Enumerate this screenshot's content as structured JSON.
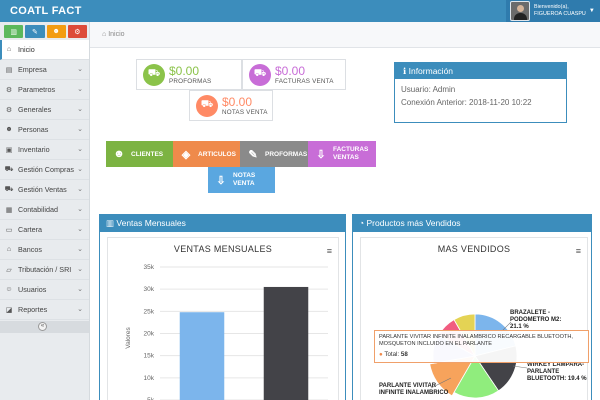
{
  "app": {
    "title": "COATL FACT"
  },
  "user": {
    "greeting": "Bienvenido(a),",
    "name": "FIGUEROA CUASPU"
  },
  "shortcuts": [
    {
      "icon": "bar-chart-icon",
      "color": "#5cb85c",
      "glyph": "▥"
    },
    {
      "icon": "pencil-icon",
      "color": "#3c8dbc",
      "glyph": "✎"
    },
    {
      "icon": "users-icon",
      "color": "#f39c12",
      "glyph": "☻"
    },
    {
      "icon": "cogs-icon",
      "color": "#dd4b39",
      "glyph": "⚙"
    }
  ],
  "sidebar": {
    "items": [
      {
        "label": "Inicio",
        "glyph": "⌂",
        "icon": "home-icon",
        "active": true,
        "chevron": false
      },
      {
        "label": "Empresa",
        "glyph": "▤",
        "icon": "building-icon",
        "active": false,
        "chevron": true
      },
      {
        "label": "Parametros",
        "glyph": "⚙",
        "icon": "gear-icon",
        "active": false,
        "chevron": true
      },
      {
        "label": "Generales",
        "glyph": "⚙",
        "icon": "cogs-icon",
        "active": false,
        "chevron": true
      },
      {
        "label": "Personas",
        "glyph": "☻",
        "icon": "users-icon",
        "active": false,
        "chevron": true
      },
      {
        "label": "Inventario",
        "glyph": "▣",
        "icon": "archive-icon",
        "active": false,
        "chevron": true
      },
      {
        "label": "Gestión Compras",
        "glyph": "⛟",
        "icon": "cart-icon",
        "active": false,
        "chevron": true
      },
      {
        "label": "Gestión Ventas",
        "glyph": "⛟",
        "icon": "cart-icon",
        "active": false,
        "chevron": true
      },
      {
        "label": "Contabilidad",
        "glyph": "▦",
        "icon": "table-icon",
        "active": false,
        "chevron": true
      },
      {
        "label": "Cartera",
        "glyph": "▭",
        "icon": "wallet-icon",
        "active": false,
        "chevron": true
      },
      {
        "label": "Bancos",
        "glyph": "⌂",
        "icon": "bank-icon",
        "active": false,
        "chevron": true
      },
      {
        "label": "Tributación / SRI",
        "glyph": "▱",
        "icon": "folder-open-icon",
        "active": false,
        "chevron": true
      },
      {
        "label": "Usuarios",
        "glyph": "☺",
        "icon": "user-icon",
        "active": false,
        "chevron": true
      },
      {
        "label": "Reportes",
        "glyph": "◪",
        "icon": "chart-icon",
        "active": false,
        "chevron": true
      }
    ]
  },
  "breadcrumb": {
    "label": "Inicio"
  },
  "stats": [
    {
      "value": "$0.00",
      "label": "PROFORMAS",
      "color": "#8bc34a",
      "glyph": "⛟"
    },
    {
      "value": "$0.00",
      "label": "FACTURAS VENTA",
      "color": "#c86dd7",
      "glyph": "⛟"
    },
    {
      "value": "$0.00",
      "label": "NOTAS VENTA",
      "color": "#ff8a65",
      "glyph": "⛟"
    }
  ],
  "info": {
    "title": "Información",
    "usuario": "Usuario: Admin",
    "conexion": "Conexión Anterior: 2018-11-20 10:22"
  },
  "quick_buttons": [
    {
      "label": "CLIENTES",
      "color": "#7cb342",
      "icon": "user-icon",
      "glyph": "☻"
    },
    {
      "label": "ARTICULOS",
      "color": "#ef8a4b",
      "icon": "cube-icon",
      "glyph": "◈"
    },
    {
      "label": "PROFORMAS",
      "color": "#8a8a8a",
      "icon": "edit-icon",
      "glyph": "✎"
    },
    {
      "label": "FACTURAS VENTAS",
      "color": "#c86dd7",
      "icon": "download-icon",
      "glyph": "⇩"
    },
    {
      "label": "NOTAS VENTA",
      "color": "#5aa7e0",
      "icon": "download-icon",
      "glyph": "⇩"
    }
  ],
  "panels": {
    "ventas": {
      "title": "Ventas Mensuales",
      "chart_title": "VENTAS MENSUALES"
    },
    "productos": {
      "title": "Productos más Vendidos",
      "chart_title": "MAS VENDIDOS"
    }
  },
  "chart_data": [
    {
      "type": "bar",
      "title": "VENTAS MENSUALES",
      "ylabel": "Valores",
      "yticks": [
        "35k",
        "30k",
        "25k",
        "20k",
        "15k",
        "10k",
        "5k"
      ],
      "ylim": [
        5000,
        35000
      ],
      "series": [
        {
          "value": 24800,
          "color": "#7cb5ec"
        },
        {
          "value": 30500,
          "color": "#434348"
        }
      ]
    },
    {
      "type": "pie",
      "title": "MAS VENDIDOS",
      "labels": [
        {
          "text": "BRAZALETE - PODOMETRO M2: 21.1 %",
          "value": 21.1
        },
        {
          "text": "WIRKEY LAMPARA-PARLANTE BLUETOOTH: 19.4 %",
          "value": 19.4
        },
        {
          "text": "PARLANTE VIVITAR INFINITE INALAMBRICO",
          "value": null
        }
      ],
      "tooltip": {
        "name": "PARLANTE VIVITAR INFINITE INALAMBRICO RECARGABLE BLUETOOTH, MOSQUETON INCLUIDO EN EL PARLANTE",
        "total_label": "Total:",
        "total_value": "58"
      }
    }
  ]
}
